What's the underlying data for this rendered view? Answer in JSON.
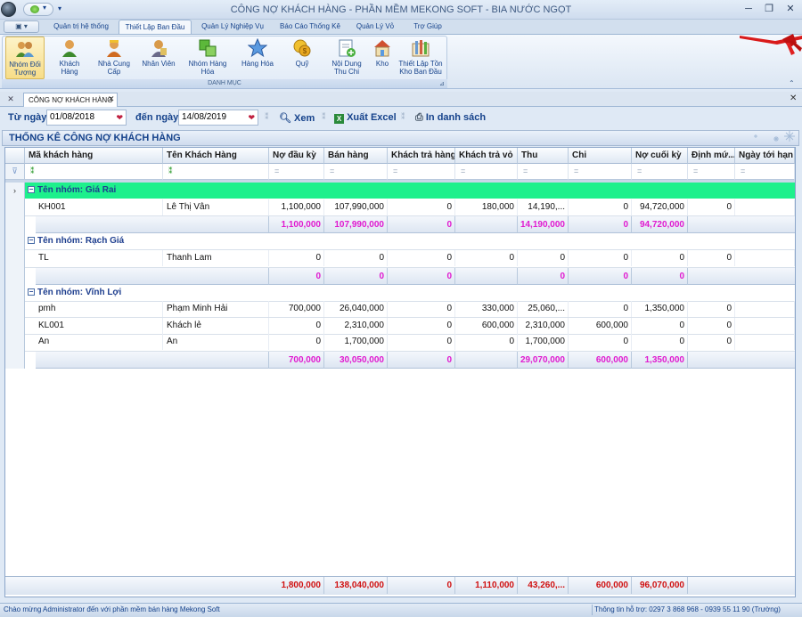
{
  "window": {
    "title": "CÔNG NỢ KHÁCH HÀNG - PHẦN MỀM MEKONG SOFT - BIA NƯỚC NGỌT",
    "minimize": "─",
    "maximize": "❐",
    "close": "✕"
  },
  "ribbon": {
    "tabs": [
      "Quản trị hệ thống",
      "Thiết Lập Ban Đầu",
      "Quản Lý Nghiệp Vụ",
      "Báo Cáo Thống Kê",
      "Quản Lý Vỏ",
      "Trợ Giúp"
    ],
    "active_tab": "Thiết Lập Ban Đầu",
    "buttons": [
      {
        "line1": "Nhóm Đối",
        "line2": "Tượng",
        "icon": "group-users-icon"
      },
      {
        "line1": "Khách",
        "line2": "Hàng",
        "icon": "customer-icon"
      },
      {
        "line1": "Nhà Cung",
        "line2": "Cấp",
        "icon": "supplier-icon"
      },
      {
        "line1": "Nhân Viên",
        "line2": "",
        "icon": "employee-icon"
      },
      {
        "line1": "Nhóm Hàng",
        "line2": "Hóa",
        "icon": "product-group-icon"
      },
      {
        "line1": "Hàng Hóa",
        "line2": "",
        "icon": "star-icon"
      },
      {
        "line1": "Quỹ",
        "line2": "",
        "icon": "coins-icon"
      },
      {
        "line1": "Nội Dung",
        "line2": "Thu Chi",
        "icon": "document-add-icon"
      },
      {
        "line1": "Kho",
        "line2": "",
        "icon": "warehouse-icon"
      },
      {
        "line1": "Thiết Lập Tồn",
        "line2": "Kho Ban Đầu",
        "icon": "inventory-icon"
      }
    ],
    "group_label": "DANH MỤC"
  },
  "doc_tab": {
    "label": "CÔNG NỢ KHÁCH HÀNG"
  },
  "filter": {
    "from_label": "Từ ngày",
    "from_value": "01/08/2018",
    "to_label": "đến ngày",
    "to_value": "14/08/2019",
    "view_label": "Xem",
    "export_label": "Xuất Excel",
    "print_label": "In danh sách"
  },
  "panel": {
    "title": "THỐNG KÊ CÔNG NỢ KHÁCH HÀNG"
  },
  "grid": {
    "columns": [
      "Mã khách hàng",
      "Tên Khách Hàng",
      "Nợ đầu kỳ",
      "Bán hàng",
      "Khách trả hàng",
      "Khách trả vỏ",
      "Thu",
      "Chi",
      "Nợ cuối kỳ",
      "Định mứ...",
      "Ngày tới hạn"
    ],
    "filter_symbols": [
      "⁑",
      "=",
      "=",
      "=",
      "=",
      "=",
      "=",
      "=",
      "=",
      "="
    ],
    "groups": [
      {
        "label": "Tên nhóm: Giá Rai",
        "rows": [
          [
            "KH001",
            "Lê Thị Vân",
            "1,100,000",
            "107,990,000",
            "0",
            "180,000",
            "14,190,...",
            "0",
            "94,720,000",
            "0",
            ""
          ]
        ],
        "totals": [
          "1,100,000",
          "107,990,000",
          "0",
          "",
          "14,190,000",
          "0",
          "94,720,000"
        ]
      },
      {
        "label": "Tên nhóm: Rạch Giá",
        "rows": [
          [
            "TL",
            "Thanh Lam",
            "0",
            "0",
            "0",
            "0",
            "0",
            "0",
            "0",
            "0",
            ""
          ]
        ],
        "totals": [
          "0",
          "0",
          "0",
          "",
          "0",
          "0",
          "0"
        ]
      },
      {
        "label": "Tên nhóm: Vĩnh Lợi",
        "rows": [
          [
            "pmh",
            "Phạm Minh Hải",
            "700,000",
            "26,040,000",
            "0",
            "330,000",
            "25,060,...",
            "0",
            "1,350,000",
            "0",
            ""
          ],
          [
            "KL001",
            "Khách lẻ",
            "0",
            "2,310,000",
            "0",
            "600,000",
            "2,310,000",
            "600,000",
            "0",
            "0",
            ""
          ],
          [
            "An",
            "An",
            "0",
            "1,700,000",
            "0",
            "0",
            "1,700,000",
            "0",
            "0",
            "0",
            ""
          ]
        ],
        "totals": [
          "700,000",
          "30,050,000",
          "0",
          "",
          "29,070,000",
          "600,000",
          "1,350,000"
        ]
      }
    ],
    "grand_totals": [
      "1,800,000",
      "138,040,000",
      "0",
      "1,110,000",
      "43,260,...",
      "600,000",
      "96,070,000"
    ]
  },
  "status": {
    "left": "Chào mừng Administrator đến với phần mềm bán hàng Mekong Soft",
    "right": "Thông tin hỗ trợ: 0297 3 868 968 - 0939 55 11 90 (Trường)"
  },
  "colors": {
    "group_highlight": "#1ef08c",
    "subtotal_text": "#e01ad0",
    "grand_total_text": "#d01010",
    "header_text": "#15428b"
  }
}
